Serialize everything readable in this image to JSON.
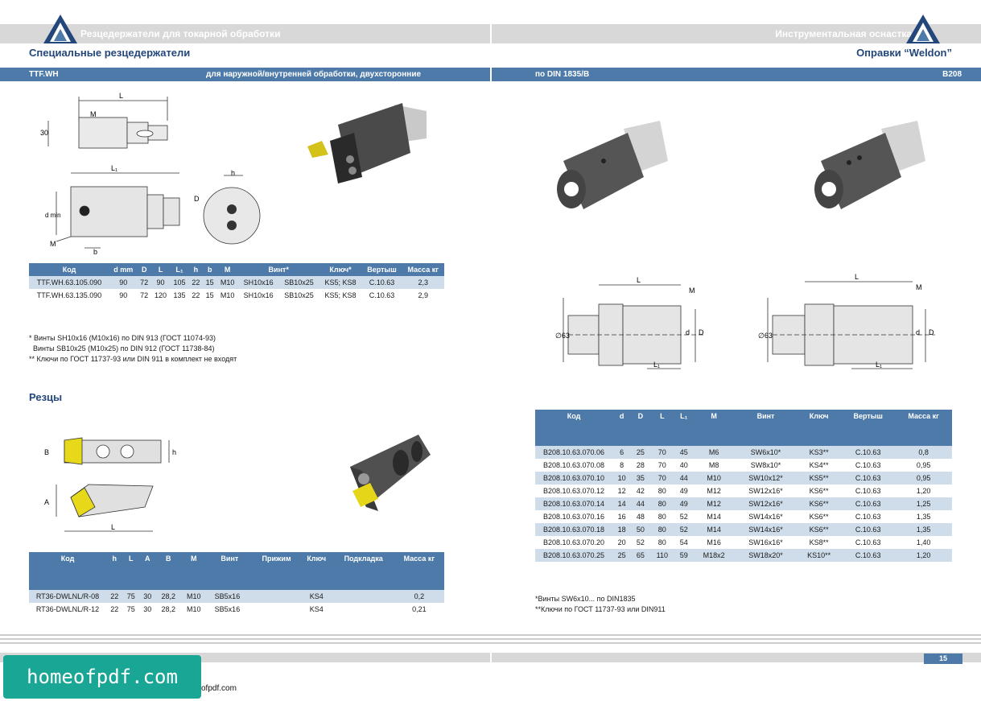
{
  "header": {
    "left_title": "Резцедержатели для токарной обработки",
    "right_title": "Инструментальная оснастка",
    "left_subtitle": "Специальные резцедержатели",
    "right_subtitle": "Оправки “Weldon”"
  },
  "bluebar_left": {
    "code": "TTF.WH",
    "desc": "для наружной/внутренней обработки, двухсторонние"
  },
  "bluebar_right": {
    "desc": "по DIN 1835/B",
    "code": "B208"
  },
  "drawing_labels": {
    "L": "L",
    "M": "M",
    "h30": "30",
    "L1": "L₁",
    "h": "h",
    "D": "D",
    "dmin": "d min",
    "b": "b",
    "d": "d",
    "dia63": "∅63",
    "B": "B",
    "A": "A"
  },
  "table1": {
    "headers": [
      "Код",
      "d mm",
      "D",
      "L",
      "L₁",
      "h",
      "b",
      "M",
      "Винт*",
      "",
      "Ключ*",
      "Вертыш",
      "Масса кг"
    ],
    "rows": [
      [
        "TTF.WH.63.105.090",
        "90",
        "72",
        "90",
        "105",
        "22",
        "15",
        "M10",
        "SH10x16",
        "SB10x25",
        "KS5; KS8",
        "C.10.63",
        "2,3"
      ],
      [
        "TTF.WH.63.135.090",
        "90",
        "72",
        "120",
        "135",
        "22",
        "15",
        "M10",
        "SH10x16",
        "SB10x25",
        "KS5; KS8",
        "C.10.63",
        "2,9"
      ]
    ]
  },
  "notes1": [
    "* Винты SH10x16 (M10x16) по DIN 913 (ГОСТ 11074-93)",
    "  Винты SB10x25 (M10x25) по DIN 912 (ГОСТ 11738-84)",
    "** Ключи по ГОСТ 11737-93 или DIN 911 в комплект не входят"
  ],
  "section_cutters": "Резцы",
  "table2": {
    "headers": [
      "Код",
      "h",
      "L",
      "A",
      "B",
      "M",
      "Винт",
      "",
      "Прижим",
      "Ключ",
      "Подкладка",
      "Масса кг"
    ],
    "rows": [
      [
        "RT36-DWLNL/R-08",
        "22",
        "75",
        "30",
        "28,2",
        "M10",
        "SB5x16",
        "",
        "",
        "KS4",
        "",
        "0,2"
      ],
      [
        "RT36-DWLNL/R-12",
        "22",
        "75",
        "30",
        "28,2",
        "M10",
        "SB5x16",
        "",
        "",
        "KS4",
        "",
        "0,21"
      ]
    ]
  },
  "table3": {
    "headers": [
      "Код",
      "d",
      "D",
      "L",
      "L₁",
      "M",
      "Винт",
      "Ключ",
      "Вертыш",
      "Масса кг"
    ],
    "rows": [
      [
        "B208.10.63.070.06",
        "6",
        "25",
        "70",
        "45",
        "M6",
        "SW6x10*",
        "KS3**",
        "C.10.63",
        "0,8"
      ],
      [
        "B208.10.63.070.08",
        "8",
        "28",
        "70",
        "40",
        "M8",
        "SW8x10*",
        "KS4**",
        "C.10.63",
        "0,95"
      ],
      [
        "B208.10.63.070.10",
        "10",
        "35",
        "70",
        "44",
        "M10",
        "SW10x12*",
        "KS5**",
        "C.10.63",
        "0,95"
      ],
      [
        "B208.10.63.070.12",
        "12",
        "42",
        "80",
        "49",
        "M12",
        "SW12x16*",
        "KS6**",
        "C.10.63",
        "1,20"
      ],
      [
        "B208.10.63.070.14",
        "14",
        "44",
        "80",
        "49",
        "M12",
        "SW12x16*",
        "KS6**",
        "C.10.63",
        "1,25"
      ],
      [
        "B208.10.63.070.16",
        "16",
        "48",
        "80",
        "52",
        "M14",
        "SW14x16*",
        "KS6**",
        "C.10.63",
        "1,35"
      ],
      [
        "B208.10.63.070.18",
        "18",
        "50",
        "80",
        "52",
        "M14",
        "SW14x16*",
        "KS6**",
        "C.10.63",
        "1,35"
      ],
      [
        "B208.10.63.070.20",
        "20",
        "52",
        "80",
        "54",
        "M16",
        "SW16x16*",
        "KS8**",
        "C.10.63",
        "1,40"
      ],
      [
        "B208.10.63.070.25",
        "25",
        "65",
        "110",
        "59",
        "M18x2",
        "SW18x20*",
        "KS10**",
        "C.10.63",
        "1,20"
      ]
    ]
  },
  "notes3": [
    "*Винты SW6x10... по DIN1835",
    "**Ключи по ГОСТ 11737-93 или DIN911"
  ],
  "page_number": "15",
  "watermark": "homeofpdf.com",
  "watermark_url": "ofpdf.com",
  "colors": {
    "bar_blue": "#4d7aa8",
    "title_blue": "#23477a",
    "row_blue": "#cfddea",
    "gray_bar": "#d8d8d8",
    "watermark": "#1aa695"
  }
}
